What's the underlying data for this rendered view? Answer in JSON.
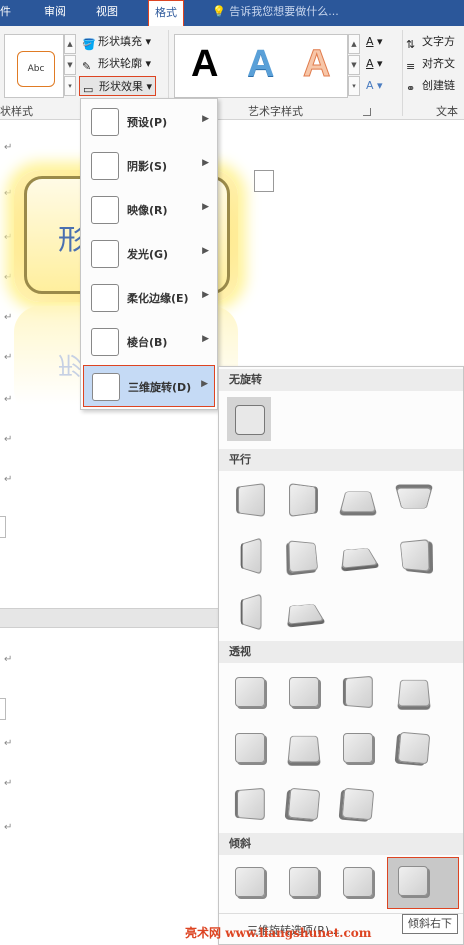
{
  "tabs": [
    {
      "label": "件",
      "active": false
    },
    {
      "label": "审阅",
      "active": false
    },
    {
      "label": "视图",
      "active": false
    },
    {
      "label": "格式",
      "active": true
    }
  ],
  "tell_me": "告诉我您想要做什么...",
  "ribbon": {
    "shape_style_thumb": "Abc",
    "shape_fill": "形状填充",
    "shape_outline": "形状轮廓",
    "shape_effects": "形状效果",
    "group_shape_styles": "状样式",
    "wordart_samples": [
      "A",
      "A",
      "A"
    ],
    "group_wordart": "艺术字样式",
    "text_direction": "文字方",
    "align_text": "对齐文",
    "create_link": "创建链",
    "group_text": "文本"
  },
  "document": {
    "shape_text": "形状"
  },
  "effects_menu": [
    {
      "label": "预设(P)"
    },
    {
      "label": "阴影(S)"
    },
    {
      "label": "映像(R)"
    },
    {
      "label": "发光(G)"
    },
    {
      "label": "柔化边缘(E)"
    },
    {
      "label": "棱台(B)"
    },
    {
      "label": "三维旋转(D)",
      "selected": true
    }
  ],
  "rotation_gallery": {
    "sections": [
      {
        "title": "无旋转"
      },
      {
        "title": "平行"
      },
      {
        "title": "透视"
      },
      {
        "title": "倾斜"
      }
    ],
    "footer_label": "三维旋转选项(R)...",
    "tooltip": "倾斜右下"
  },
  "watermark": {
    "brand": "亮术网",
    "site": "www.liangshunet.com"
  }
}
